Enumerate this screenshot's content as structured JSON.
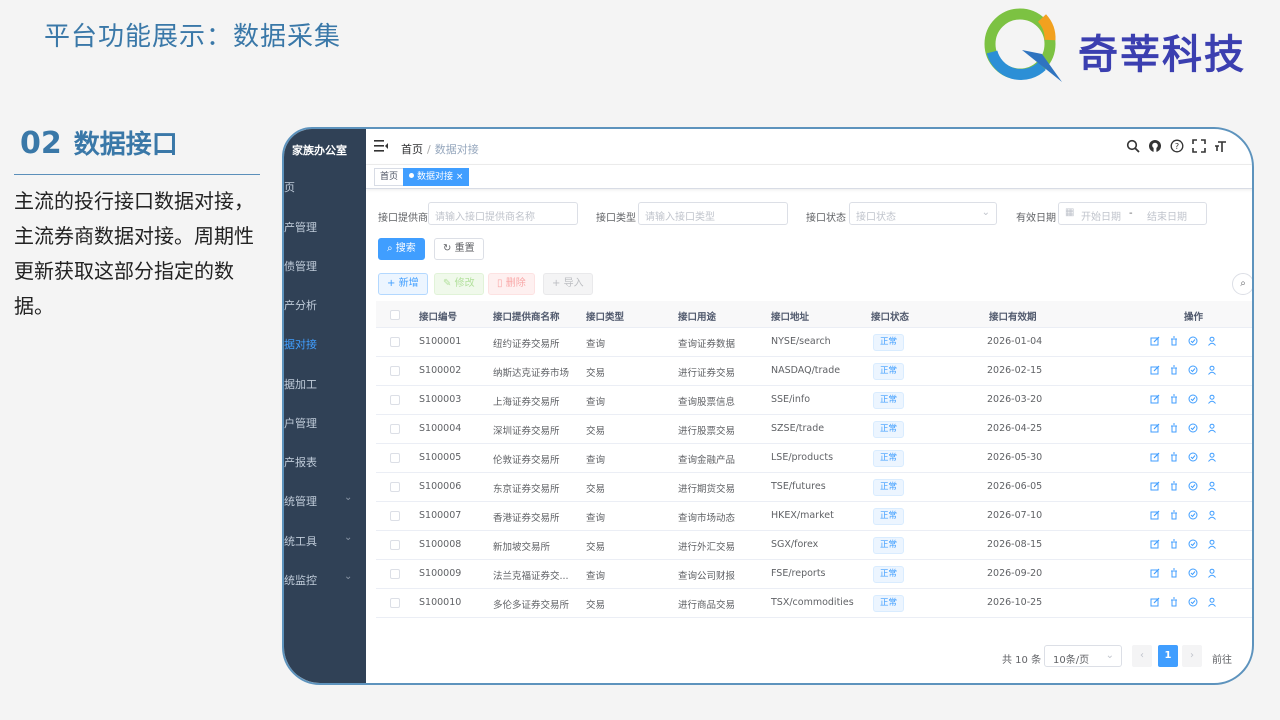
{
  "slide": {
    "title": "平台功能展示：数据采集",
    "brand_name": "奇莘科技",
    "section_num": "02",
    "section_name": "数据接口",
    "description": "主流的投行接口数据对接，主流券商数据对接。周期性更新获取这部分指定的数据。"
  },
  "sidebar": {
    "org": "家族办公室",
    "items": [
      {
        "label": "页",
        "active": false,
        "chevron": false
      },
      {
        "label": "产管理",
        "active": false,
        "chevron": false
      },
      {
        "label": "债管理",
        "active": false,
        "chevron": false
      },
      {
        "label": "产分析",
        "active": false,
        "chevron": false
      },
      {
        "label": "据对接",
        "active": true,
        "chevron": false
      },
      {
        "label": "据加工",
        "active": false,
        "chevron": false
      },
      {
        "label": "户管理",
        "active": false,
        "chevron": false
      },
      {
        "label": "产报表",
        "active": false,
        "chevron": false
      },
      {
        "label": "统管理",
        "active": false,
        "chevron": true
      },
      {
        "label": "统工具",
        "active": false,
        "chevron": true
      },
      {
        "label": "统监控",
        "active": false,
        "chevron": true
      }
    ]
  },
  "topbar": {
    "breadcrumb_home": "首页",
    "breadcrumb_sep": "/",
    "breadcrumb_current": "数据对接"
  },
  "tags": {
    "home": "首页",
    "active": "数据对接",
    "close": "×"
  },
  "filters": {
    "provider_label": "接口提供商",
    "provider_placeholder": "请输入接口提供商名称",
    "type_label": "接口类型",
    "type_placeholder": "请输入接口类型",
    "status_label": "接口状态",
    "status_placeholder": "接口状态",
    "date_label": "有效日期",
    "date_start": "开始日期",
    "date_sep": "-",
    "date_end": "结束日期",
    "search_btn": "搜索",
    "reset_btn": "重置"
  },
  "actions": {
    "add": "新增",
    "edit": "修改",
    "delete": "删除",
    "import": "导入"
  },
  "table": {
    "headers": [
      "接口编号",
      "接口提供商名称",
      "接口类型",
      "接口用途",
      "接口地址",
      "接口状态",
      "接口有效期",
      "操作"
    ],
    "rows": [
      {
        "id": "S100001",
        "provider": "纽约证券交易所",
        "type": "查询",
        "use": "查询证券数据",
        "addr": "NYSE/search",
        "status": "正常",
        "date": "2026-01-04"
      },
      {
        "id": "S100002",
        "provider": "纳斯达克证券市场",
        "type": "交易",
        "use": "进行证券交易",
        "addr": "NASDAQ/trade",
        "status": "正常",
        "date": "2026-02-15"
      },
      {
        "id": "S100003",
        "provider": "上海证券交易所",
        "type": "查询",
        "use": "查询股票信息",
        "addr": "SSE/info",
        "status": "正常",
        "date": "2026-03-20"
      },
      {
        "id": "S100004",
        "provider": "深圳证券交易所",
        "type": "交易",
        "use": "进行股票交易",
        "addr": "SZSE/trade",
        "status": "正常",
        "date": "2026-04-25"
      },
      {
        "id": "S100005",
        "provider": "伦敦证券交易所",
        "type": "查询",
        "use": "查询金融产品",
        "addr": "LSE/products",
        "status": "正常",
        "date": "2026-05-30"
      },
      {
        "id": "S100006",
        "provider": "东京证券交易所",
        "type": "交易",
        "use": "进行期货交易",
        "addr": "TSE/futures",
        "status": "正常",
        "date": "2026-06-05"
      },
      {
        "id": "S100007",
        "provider": "香港证券交易所",
        "type": "查询",
        "use": "查询市场动态",
        "addr": "HKEX/market",
        "status": "正常",
        "date": "2026-07-10"
      },
      {
        "id": "S100008",
        "provider": "新加坡交易所",
        "type": "交易",
        "use": "进行外汇交易",
        "addr": "SGX/forex",
        "status": "正常",
        "date": "2026-08-15"
      },
      {
        "id": "S100009",
        "provider": "法兰克福证券交...",
        "type": "查询",
        "use": "查询公司财报",
        "addr": "FSE/reports",
        "status": "正常",
        "date": "2026-09-20"
      },
      {
        "id": "S100010",
        "provider": "多伦多证券交易所",
        "type": "交易",
        "use": "进行商品交易",
        "addr": "TSX/commodities",
        "status": "正常",
        "date": "2026-10-25"
      }
    ]
  },
  "pagination": {
    "total": "共 10 条",
    "page_size": "10条/页",
    "current_page": "1",
    "prev": "‹",
    "next": "›",
    "goto": "前往"
  }
}
